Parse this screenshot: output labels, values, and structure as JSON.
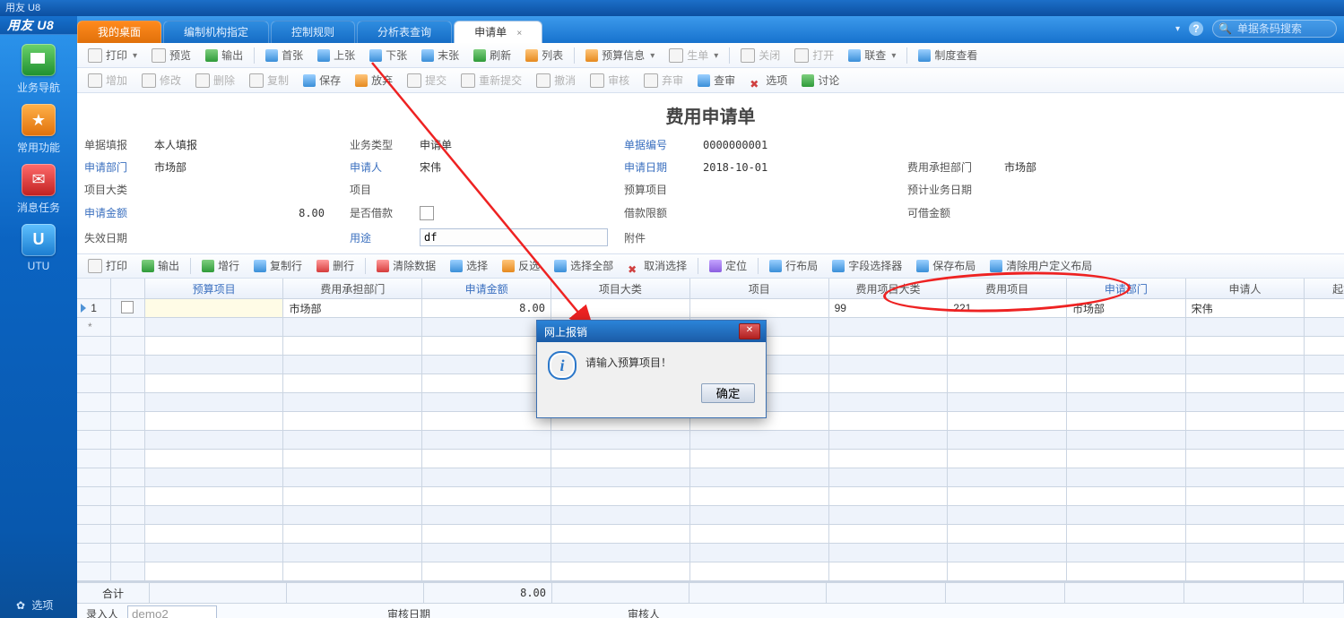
{
  "window": {
    "title": "用友 U8"
  },
  "sidebar": {
    "items": [
      {
        "label": "业务导航",
        "iconClass": "ic-nav"
      },
      {
        "label": "常用功能",
        "iconClass": "ic-fav"
      },
      {
        "label": "消息任务",
        "iconClass": "ic-task"
      },
      {
        "label": "UTU",
        "iconClass": "ic-utu"
      }
    ],
    "bottom_label": "选项"
  },
  "tabs": {
    "home": {
      "label": "我的桌面"
    },
    "items": [
      {
        "label": "编制机构指定"
      },
      {
        "label": "控制规则"
      },
      {
        "label": "分析表查询"
      }
    ],
    "active": {
      "label": "申请单",
      "close": "×"
    }
  },
  "tabright": {
    "help": "?",
    "search_placeholder": "单据条码搜索"
  },
  "toolbar1": {
    "print": "打印",
    "preview": "预览",
    "export": "输出",
    "first": "首张",
    "prev": "上张",
    "next": "下张",
    "last": "末张",
    "refresh": "刷新",
    "list": "列表",
    "budget": "预算信息",
    "make": "生单",
    "close": "关闭",
    "open": "打开",
    "linkq": "联查",
    "rules": "制度查看"
  },
  "toolbar2": {
    "add": "增加",
    "edit": "修改",
    "del": "删除",
    "copy": "复制",
    "save": "保存",
    "abandon": "放弃",
    "submit": "提交",
    "resubmit": "重新提交",
    "revoke": "撤消",
    "audit": "审核",
    "discard": "弃审",
    "review": "查审",
    "options": "选项",
    "discuss": "讨论"
  },
  "doc": {
    "title": "费用申请单",
    "rows": {
      "r1": {
        "l1": "单据填报",
        "v1": "本人填报",
        "l2": "业务类型",
        "v2": "申请单",
        "l3": "单据编号",
        "v3": "0000000001"
      },
      "r2": {
        "l1": "申请部门",
        "v1": "市场部",
        "l2": "申请人",
        "v2": "宋伟",
        "l3": "申请日期",
        "v3": "2018-10-01",
        "l4": "费用承担部门",
        "v4": "市场部"
      },
      "r3": {
        "l1": "项目大类",
        "v1": "",
        "l2": "项目",
        "v2": "",
        "l3": "预算项目",
        "v3": "",
        "l4": "预计业务日期",
        "v4": ""
      },
      "r4": {
        "l1": "申请金额",
        "v1": "8.00",
        "l2": "是否借款",
        "v2": "",
        "l3": "借款限额",
        "v3": "",
        "l4": "可借金额",
        "v4": ""
      },
      "r5": {
        "l1": "失效日期",
        "v1": "",
        "l2": "用途",
        "v2": "df",
        "l3": "附件",
        "v3": ""
      }
    }
  },
  "gridbar": {
    "print": "打印",
    "export": "输出",
    "addrow": "增行",
    "copyrow": "复制行",
    "delrow": "删行",
    "clear": "清除数据",
    "select": "选择",
    "invert": "反选",
    "selall": "选择全部",
    "unselect": "取消选择",
    "locate": "定位",
    "rowlayout": "行布局",
    "fieldsel": "字段选择器",
    "savelayout": "保存布局",
    "clearlayout": "清除用户定义布局"
  },
  "columns": [
    "预算项目",
    "费用承担部门",
    "申请金额",
    "项目大类",
    "项目",
    "费用项目大类",
    "费用项目",
    "申请部门",
    "申请人",
    "起始日期"
  ],
  "row1": {
    "dept": "市场部",
    "amount": "8.00",
    "cat": "99",
    "item": "221",
    "adept": "市场部",
    "applicant": "宋伟"
  },
  "totals": {
    "label": "合计",
    "amount": "8.00"
  },
  "footer": {
    "entry_label": "录入人",
    "entry_value": "demo2",
    "audit_date_label": "审核日期",
    "auditor_label": "审核人"
  },
  "dialog": {
    "title": "网上报销",
    "message": "请输入预算项目！",
    "ok": "确定"
  }
}
